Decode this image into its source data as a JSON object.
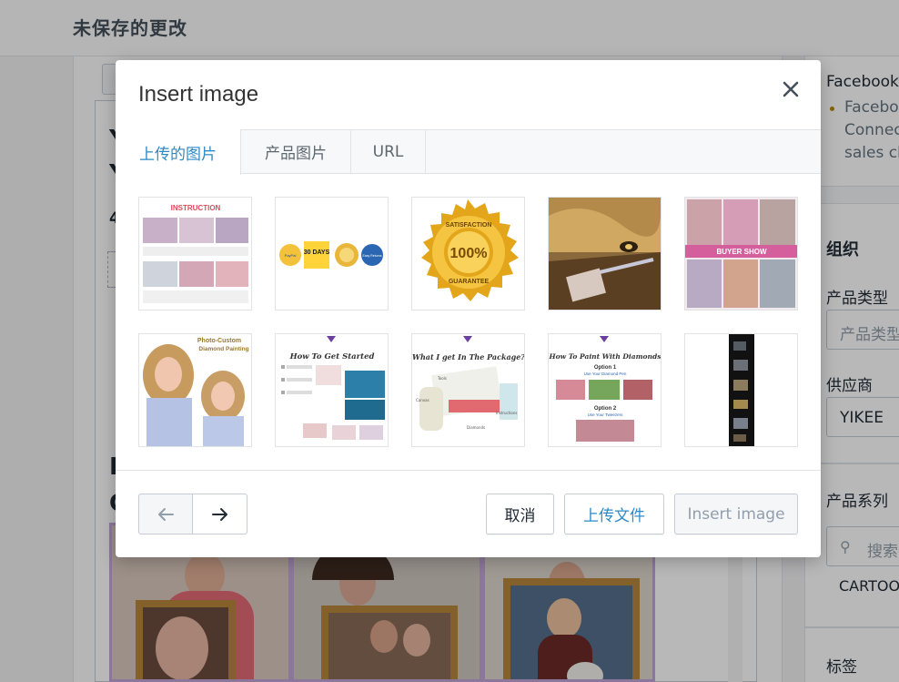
{
  "topbar": {
    "title": "未保存的更改"
  },
  "editor": {
    "chars": [
      "Y",
      "Y",
      "4",
      "F",
      "C"
    ]
  },
  "right_panel": {
    "facebook_title": "Facebook",
    "facebook_line1": "Faceboo",
    "facebook_line2": "Connec",
    "facebook_line3": "sales ch",
    "org_heading": "组织",
    "product_type_label": "产品类型",
    "product_type_placeholder": "产品类型",
    "vendor_label": "供应商",
    "vendor_value": "YIKEE",
    "collections_label": "产品系列",
    "collections_search_placeholder": "搜索",
    "collection_tag": "CARTOO",
    "tags_label": "标签"
  },
  "modal": {
    "title": "Insert image",
    "close_icon": "close-icon",
    "tabs": [
      {
        "label": "上传的图片",
        "active": true
      },
      {
        "label": "产品图片",
        "active": false
      },
      {
        "label": "URL",
        "active": false
      }
    ],
    "thumbnails": [
      {
        "caption": "INSTRUCTION"
      },
      {
        "caption": "30 DAYS",
        "badge_left": "PayPal",
        "badge_right": "Easy Returns"
      },
      {
        "caption": "100%",
        "ring_top": "SATISFACTION",
        "ring_bottom": "GUARANTEE"
      },
      {
        "caption": ""
      },
      {
        "caption": "BUYER SHOW"
      },
      {
        "caption": "Photo-Custom",
        "caption2": "Diamond Painting"
      },
      {
        "caption": "How To Get Started"
      },
      {
        "caption": "What I get In The Package?",
        "labels": [
          "Tools",
          "Canvas",
          "Instructions",
          "Diamonds"
        ]
      },
      {
        "caption": "How To Paint With Diamonds",
        "option1": "Option 1",
        "option1_sub": "Use Your Diamond Pen",
        "option2": "Option 2",
        "option2_sub": "Use Your Tweezers"
      },
      {
        "caption": ""
      }
    ],
    "footer": {
      "prev_icon": "arrow-left-icon",
      "next_icon": "arrow-right-icon",
      "cancel": "取消",
      "upload": "上传文件",
      "insert": "Insert image"
    }
  },
  "colors": {
    "accent": "#2d8ac5",
    "overlay": "rgba(0,0,0,0.28)",
    "gold": "#e3a61a"
  }
}
